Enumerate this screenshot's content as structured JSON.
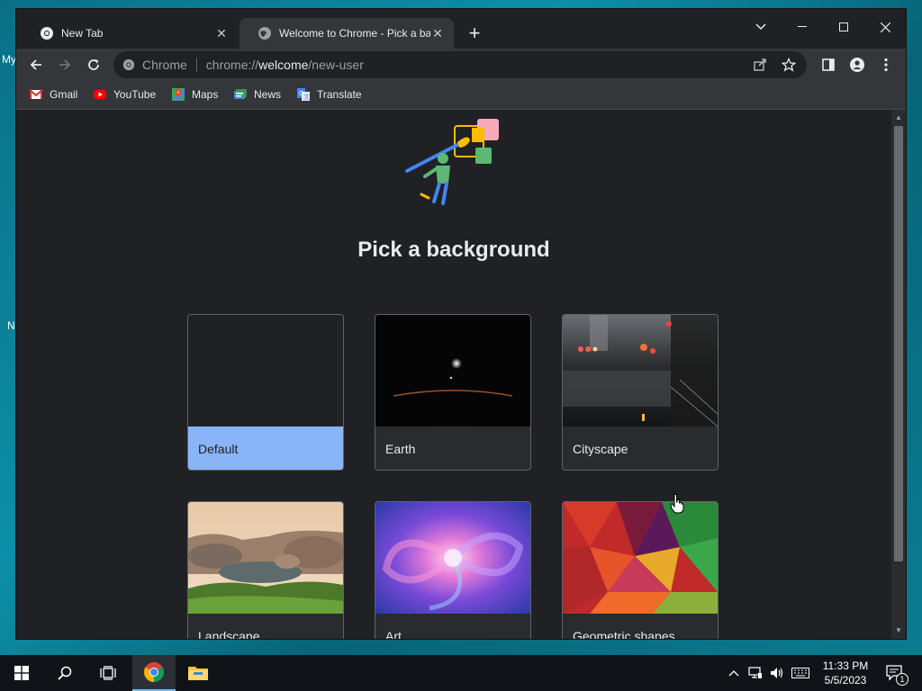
{
  "desktop": {
    "labels": [
      "My",
      "N"
    ]
  },
  "tabs": [
    {
      "title": "New Tab",
      "active": false
    },
    {
      "title": "Welcome to Chrome - Pick a background",
      "active": true
    }
  ],
  "toolbar": {
    "site_chip": "Chrome",
    "url_scheme": "chrome://",
    "url_host": "welcome",
    "url_path": "/new-user"
  },
  "bookmarks": [
    {
      "label": "Gmail",
      "icon": "gmail-icon"
    },
    {
      "label": "YouTube",
      "icon": "youtube-icon"
    },
    {
      "label": "Maps",
      "icon": "maps-icon"
    },
    {
      "label": "News",
      "icon": "news-icon"
    },
    {
      "label": "Translate",
      "icon": "translate-icon"
    }
  ],
  "page": {
    "heading": "Pick a background",
    "backgrounds": [
      {
        "label": "Default",
        "selected": true
      },
      {
        "label": "Earth",
        "selected": false
      },
      {
        "label": "Cityscape",
        "selected": false
      },
      {
        "label": "Landscape",
        "selected": false
      },
      {
        "label": "Art",
        "selected": false
      },
      {
        "label": "Geometric shapes",
        "selected": false
      }
    ]
  },
  "taskbar": {
    "time": "11:33 PM",
    "date": "5/5/2023",
    "notification_count": "1"
  },
  "colors": {
    "accent": "#8ab4f8",
    "chrome_dark": "#202124",
    "toolbar": "#35363a"
  }
}
